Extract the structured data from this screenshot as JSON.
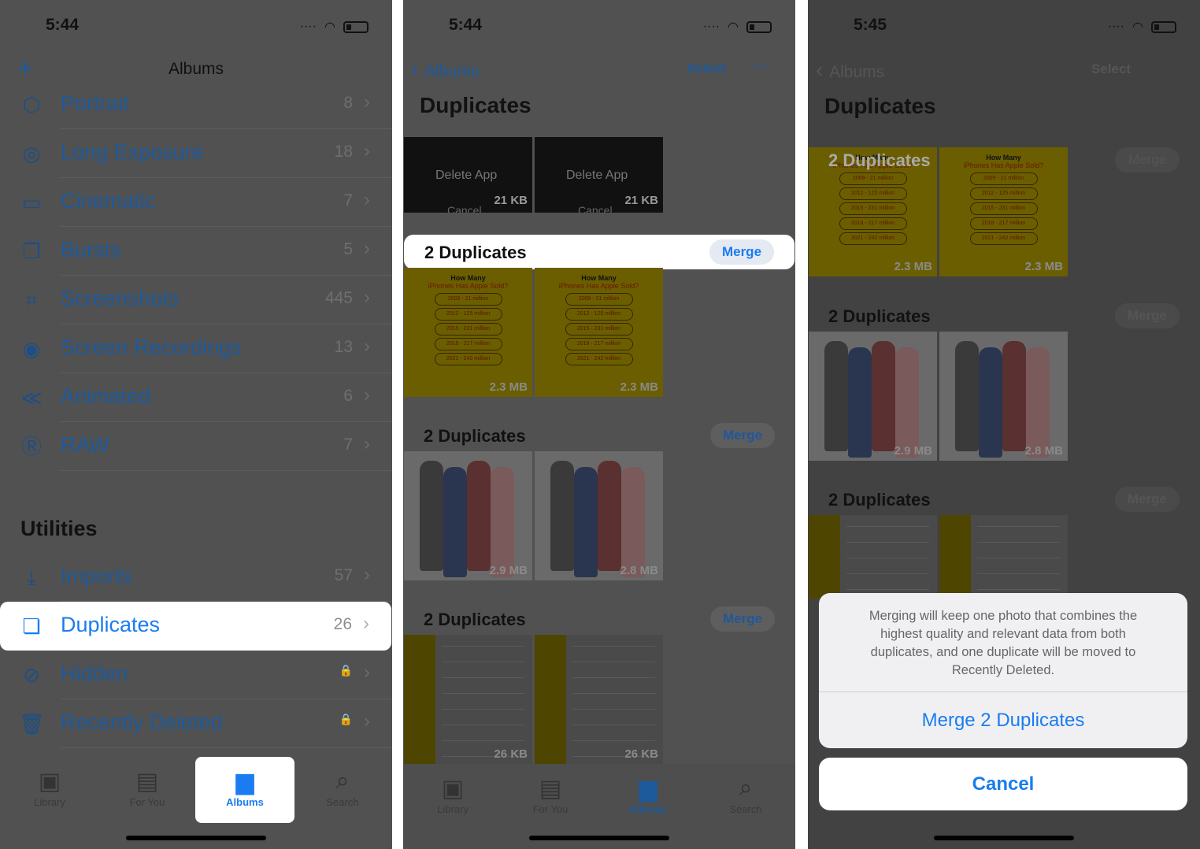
{
  "panel1": {
    "time": "5:44",
    "title": "Albums",
    "media_types": [
      {
        "label": "Portrait",
        "count": "8",
        "icon": "cube-icon"
      },
      {
        "label": "Long Exposure",
        "count": "18",
        "icon": "concentric-circles-icon"
      },
      {
        "label": "Cinematic",
        "count": "7",
        "icon": "video-viewfinder-icon"
      },
      {
        "label": "Bursts",
        "count": "5",
        "icon": "stacked-squares-icon"
      },
      {
        "label": "Screenshots",
        "count": "445",
        "icon": "camera-viewfinder-icon"
      },
      {
        "label": "Screen Recordings",
        "count": "13",
        "icon": "record-circle-icon"
      },
      {
        "label": "Animated",
        "count": "6",
        "icon": "animated-layers-icon"
      },
      {
        "label": "RAW",
        "count": "7",
        "icon": "raw-icon"
      }
    ],
    "utilities_heading": "Utilities",
    "utilities": [
      {
        "label": "Imports",
        "count": "57",
        "icon": "import-tray-icon"
      },
      {
        "label": "Duplicates",
        "count": "26",
        "icon": "duplicate-squares-icon",
        "highlighted": true
      },
      {
        "label": "Hidden",
        "count": "",
        "icon": "eye-slash-icon",
        "locked": true
      },
      {
        "label": "Recently Deleted",
        "count": "",
        "icon": "trash-icon",
        "locked": true
      }
    ]
  },
  "panel2": {
    "time": "5:44",
    "back": "Albums",
    "select": "Select",
    "more": "···",
    "title": "Duplicates",
    "first_thumbs": [
      {
        "text": "Delete App",
        "sub": "Cancel",
        "size": "21 KB"
      },
      {
        "text": "Delete App",
        "sub": "Cancel",
        "size": "21 KB"
      }
    ],
    "groups": [
      {
        "label": "2 Duplicates",
        "merge": "Merge",
        "kind": "yel",
        "sizes": [
          "2.3 MB",
          "2.3 MB"
        ]
      },
      {
        "label": "2 Duplicates",
        "merge": "Merge",
        "kind": "fig",
        "sizes": [
          "2.9 MB",
          "2.8 MB"
        ]
      },
      {
        "label": "2 Duplicates",
        "merge": "Merge",
        "kind": "set",
        "sizes": [
          "26 KB",
          "26 KB"
        ]
      }
    ]
  },
  "infographic": {
    "title": "How Many",
    "subtitle": "iPhones Has Apple Sold?",
    "rows": [
      "2009 - 21 million",
      "2012 - 125 million",
      "2015 - 231 million",
      "2018 - 217 million",
      "2021 - 242 million"
    ]
  },
  "panel3": {
    "time": "5:45",
    "back": "Albums",
    "select": "Select",
    "title": "Duplicates",
    "groups": [
      {
        "label": "2 Duplicates",
        "merge": "Merge",
        "kind": "yel",
        "sizes": [
          "2.3 MB",
          "2.3 MB"
        ]
      },
      {
        "label": "2 Duplicates",
        "merge": "Merge",
        "kind": "fig",
        "sizes": [
          "2.9 MB",
          "2.8 MB"
        ]
      },
      {
        "label": "2 Duplicates",
        "merge": "Merge",
        "kind": "set",
        "sizes": [
          "",
          ""
        ]
      }
    ],
    "sheet": {
      "message": "Merging will keep one photo that combines the highest quality and relevant data from both duplicates, and one duplicate will be moved to Recently Deleted.",
      "confirm": "Merge 2 Duplicates",
      "cancel": "Cancel"
    }
  },
  "tabs": [
    {
      "label": "Library",
      "icon": "photo-library-icon"
    },
    {
      "label": "For You",
      "icon": "for-you-icon"
    },
    {
      "label": "Albums",
      "icon": "albums-icon",
      "active": true
    },
    {
      "label": "Search",
      "icon": "search-icon"
    }
  ],
  "colors": {
    "accent": "#1a7cf0",
    "dim_bg": "#515151"
  }
}
